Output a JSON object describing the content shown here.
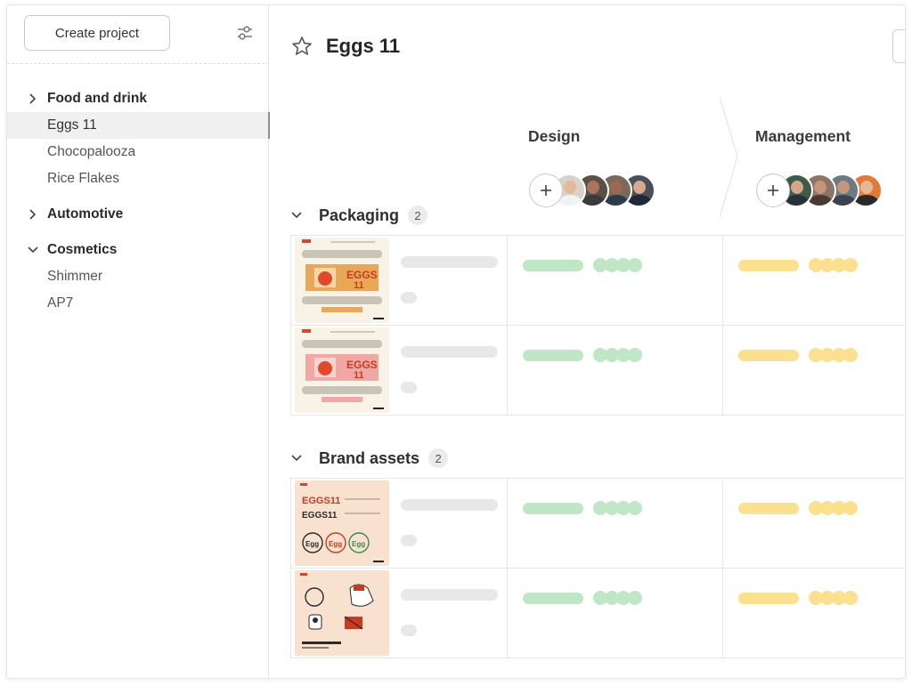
{
  "sidebar": {
    "create_label": "Create project",
    "groups": [
      {
        "label": "Food and drink",
        "expanded": false,
        "children": [
          {
            "label": "Eggs 11",
            "active": true
          },
          {
            "label": "Chocopalooza"
          },
          {
            "label": "Rice Flakes"
          }
        ]
      },
      {
        "label": "Automotive",
        "expanded": false,
        "children": []
      },
      {
        "label": "Cosmetics",
        "expanded": true,
        "children": [
          {
            "label": "Shimmer"
          },
          {
            "label": "AP7"
          }
        ]
      }
    ]
  },
  "project": {
    "title": "Eggs 11",
    "stages": [
      {
        "label": "Design",
        "color": "#bfe7c6"
      },
      {
        "label": "Management",
        "color": "#fbe08f"
      }
    ],
    "groups": [
      {
        "name": "Packaging",
        "count": "2"
      },
      {
        "name": "Brand assets",
        "count": "2"
      }
    ]
  },
  "colors": {
    "design_status": "#bfe7c6",
    "management_status": "#fbe08f",
    "skeleton": "#e8e8e8"
  }
}
